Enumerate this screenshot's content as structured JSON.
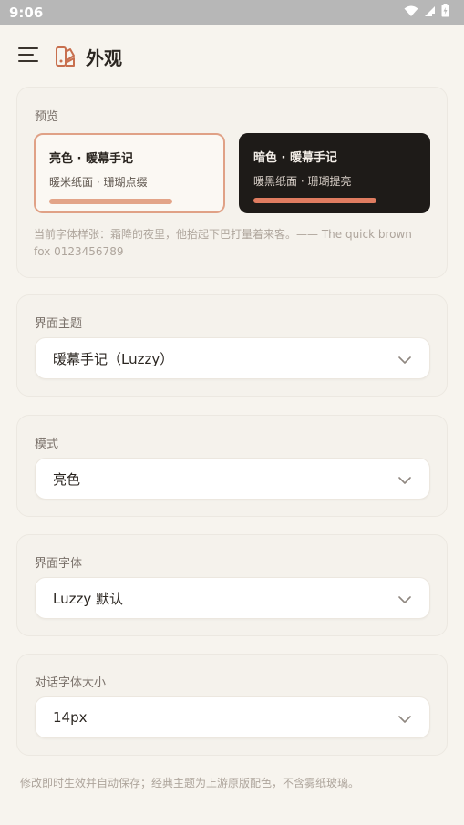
{
  "status_bar": {
    "time": "9:06",
    "icons": [
      "wifi-icon",
      "signal-icon",
      "battery-icon"
    ]
  },
  "header": {
    "title": "外观",
    "menu_icon": "menu-icon",
    "logo_icon": "palette-icon"
  },
  "preview": {
    "label": "预览",
    "light": {
      "title": "亮色 · 暖幕手记",
      "subtitle": "暖米纸面 · 珊瑚点缀"
    },
    "dark": {
      "title": "暗色 · 暖幕手记",
      "subtitle": "暖黑纸面 · 珊瑚提亮"
    },
    "sample_text": "当前字体样张：霜降的夜里，他抬起下巴打量着来客。—— The quick brown fox 0123456789"
  },
  "settings": {
    "theme": {
      "label": "界面主题",
      "value": "暖幕手记（Luzzy）"
    },
    "mode": {
      "label": "模式",
      "value": "亮色"
    },
    "ui_font": {
      "label": "界面字体",
      "value": "Luzzy 默认"
    },
    "chat_font_size": {
      "label": "对话字体大小",
      "value": "14px"
    }
  },
  "footer_note": "修改即时生效并自动保存；经典主题为上游原版配色，不含雾纸玻璃。",
  "colors": {
    "accent": "#e0a186",
    "accent_dark": "#df7c60",
    "background": "#f7f4ee",
    "dark_tile": "#1e1b18"
  }
}
